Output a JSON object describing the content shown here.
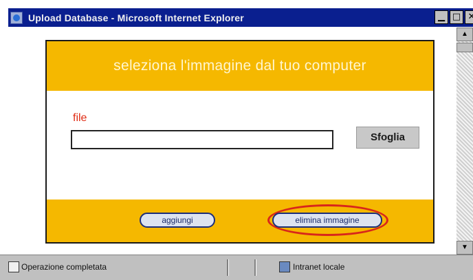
{
  "window": {
    "title": "Upload Database - Microsoft Internet Explorer",
    "buttons": {
      "minimize": "▁",
      "maximize": "□",
      "close": "✕"
    }
  },
  "scrollbar": {
    "up": "▲",
    "down": "▼"
  },
  "panel": {
    "header": "seleziona l'immagine dal tuo computer",
    "file_label": "file",
    "file_value": "",
    "browse_label": "Sfoglia",
    "add_label": "aggiungi",
    "delete_label": "elimina immagine",
    "highlight_color": "#d8261b",
    "accent_color": "#f5b800"
  },
  "statusbar": {
    "left_text": "Operazione completata",
    "right_text": "Intranet locale"
  }
}
